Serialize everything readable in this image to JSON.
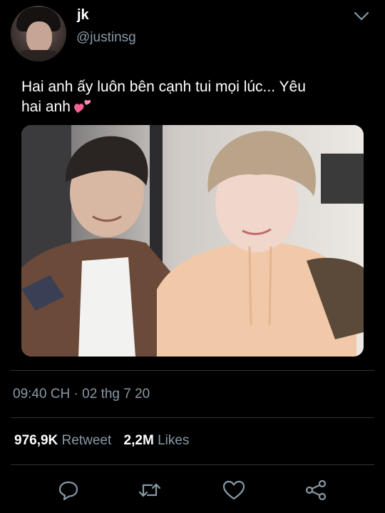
{
  "tweet": {
    "display_name": "jk",
    "handle": "@justinsg",
    "text_line1": "Hai anh ấy luôn bên cạnh tui mọi lúc... Yêu",
    "text_line2": "hai anh",
    "text_emoji": "💕",
    "timestamp": "09:40 CH · 02 thg 7 20"
  },
  "stats": {
    "retweets_count": "976,9K",
    "retweets_label": "Retweet",
    "likes_count": "2,2M",
    "likes_label": "Likes"
  },
  "icons": {
    "menu": "chevron-down-icon",
    "reply": "reply-icon",
    "retweet": "retweet-icon",
    "like": "like-icon",
    "share": "share-icon"
  },
  "colors": {
    "background": "#000000",
    "text_primary": "#ffffff",
    "text_secondary": "#8899a6",
    "divider": "#2f3336",
    "emoji_pink": "#f06292"
  }
}
